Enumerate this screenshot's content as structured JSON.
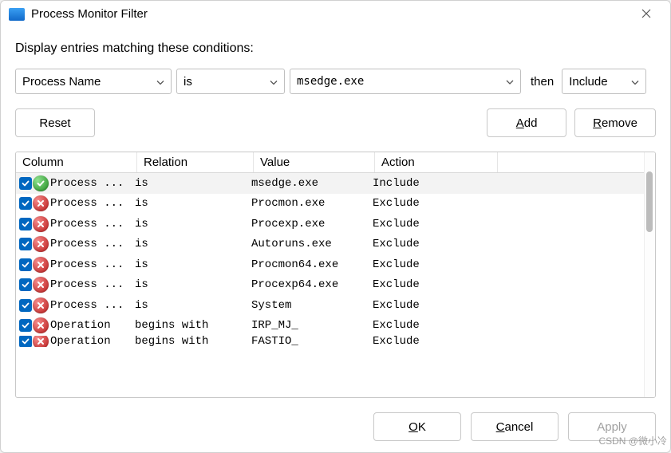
{
  "window": {
    "title": "Process Monitor Filter"
  },
  "instruction": "Display entries matching these conditions:",
  "filter": {
    "column": "Process Name",
    "relation": "is",
    "value": "msedge.exe",
    "then_label": "then",
    "action": "Include"
  },
  "buttons": {
    "reset": "Reset",
    "add": {
      "pre": "",
      "ul": "A",
      "post": "dd"
    },
    "remove": {
      "pre": "",
      "ul": "R",
      "post": "emove"
    },
    "ok": {
      "pre": "",
      "ul": "O",
      "post": "K"
    },
    "cancel": {
      "pre": "",
      "ul": "C",
      "post": "ancel"
    },
    "apply": "Apply"
  },
  "table": {
    "headers": {
      "column": "Column",
      "relation": "Relation",
      "value": "Value",
      "action": "Action"
    },
    "rows": [
      {
        "checked": true,
        "status": "include",
        "column": "Process ...",
        "relation": "is",
        "value": "msedge.exe",
        "action": "Include",
        "selected": true
      },
      {
        "checked": true,
        "status": "exclude",
        "column": "Process ...",
        "relation": "is",
        "value": "Procmon.exe",
        "action": "Exclude"
      },
      {
        "checked": true,
        "status": "exclude",
        "column": "Process ...",
        "relation": "is",
        "value": "Procexp.exe",
        "action": "Exclude"
      },
      {
        "checked": true,
        "status": "exclude",
        "column": "Process ...",
        "relation": "is",
        "value": "Autoruns.exe",
        "action": "Exclude"
      },
      {
        "checked": true,
        "status": "exclude",
        "column": "Process ...",
        "relation": "is",
        "value": "Procmon64.exe",
        "action": "Exclude"
      },
      {
        "checked": true,
        "status": "exclude",
        "column": "Process ...",
        "relation": "is",
        "value": "Procexp64.exe",
        "action": "Exclude"
      },
      {
        "checked": true,
        "status": "exclude",
        "column": "Process ...",
        "relation": "is",
        "value": "System",
        "action": "Exclude"
      },
      {
        "checked": true,
        "status": "exclude",
        "column": "Operation",
        "relation": "begins with",
        "value": "IRP_MJ_",
        "action": "Exclude"
      },
      {
        "checked": true,
        "status": "exclude",
        "column": "Operation",
        "relation": "begins with",
        "value": "FASTIO_",
        "action": "Exclude",
        "partial": true
      }
    ]
  },
  "watermark": "CSDN @微小冷"
}
